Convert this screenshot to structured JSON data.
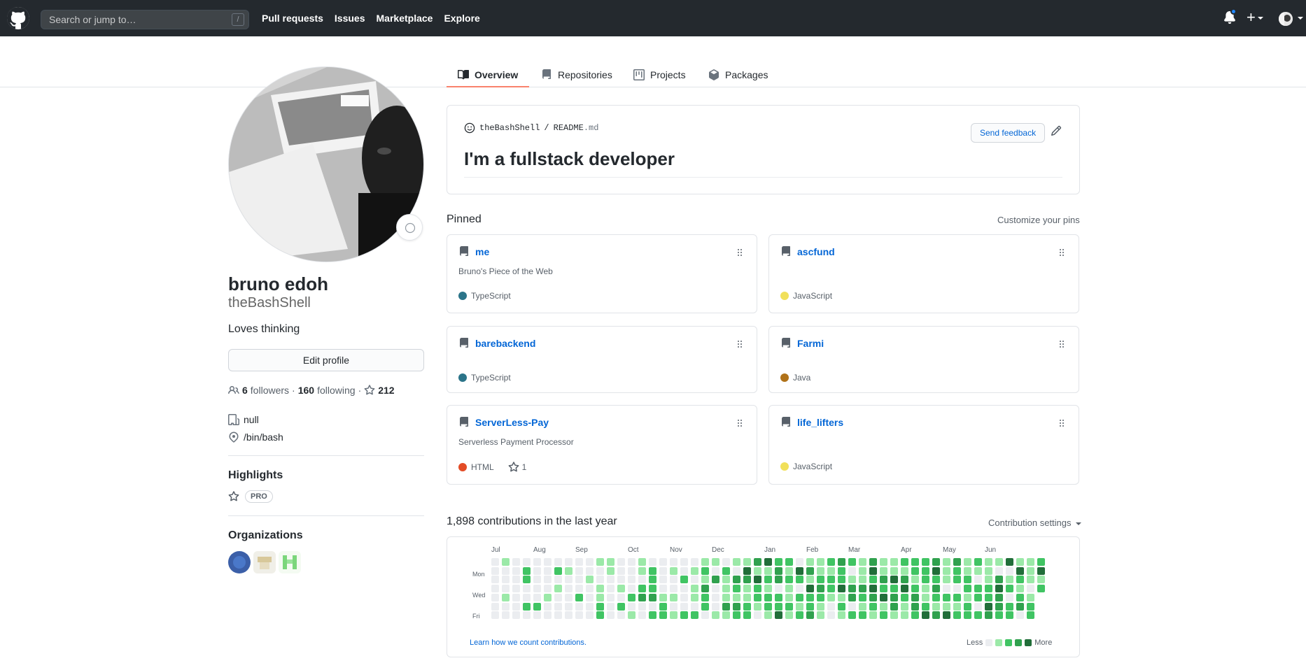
{
  "header": {
    "search_placeholder": "Search or jump to…",
    "search_shortcut": "/",
    "nav": [
      "Pull requests",
      "Issues",
      "Marketplace",
      "Explore"
    ],
    "plus_label": "+"
  },
  "tabs": [
    {
      "label": "Overview",
      "icon": "book-icon",
      "active": true
    },
    {
      "label": "Repositories",
      "icon": "repo-icon"
    },
    {
      "label": "Projects",
      "icon": "project-icon"
    },
    {
      "label": "Packages",
      "icon": "package-icon"
    }
  ],
  "profile": {
    "name": "bruno edoh",
    "login": "theBashShell",
    "bio": "Loves thinking",
    "edit_label": "Edit profile",
    "followers": "6",
    "followers_label": "followers",
    "following": "160",
    "following_label": "following",
    "stars": "212",
    "company": "null",
    "location": "/bin/bash",
    "highlights_title": "Highlights",
    "pro_badge": "PRO",
    "organizations_title": "Organizations"
  },
  "readme": {
    "owner": "theBashShell",
    "sep": "/",
    "file": "README",
    "ext": ".md",
    "feedback_label": "Send feedback",
    "heading": "I'm a fullstack developer"
  },
  "pinned": {
    "title": "Pinned",
    "customize": "Customize your pins",
    "repos": [
      {
        "name": "me",
        "desc": "Bruno's Piece of the Web",
        "lang": "TypeScript",
        "color": "#2b7489"
      },
      {
        "name": "ascfund",
        "desc": "",
        "lang": "JavaScript",
        "color": "#f1e05a"
      },
      {
        "name": "barebackend",
        "desc": "",
        "lang": "TypeScript",
        "color": "#2b7489"
      },
      {
        "name": "Farmi",
        "desc": "",
        "lang": "Java",
        "color": "#b07219"
      },
      {
        "name": "ServerLess-Pay",
        "desc": "Serverless Payment Processor",
        "lang": "HTML",
        "color": "#e34c26",
        "stars": "1"
      },
      {
        "name": "life_lifters",
        "desc": "",
        "lang": "JavaScript",
        "color": "#f1e05a"
      }
    ]
  },
  "contributions": {
    "title": "1,898 contributions in the last year",
    "settings": "Contribution settings",
    "months": [
      "Jul",
      "Aug",
      "Sep",
      "Oct",
      "Nov",
      "Dec",
      "Jan",
      "Feb",
      "Mar",
      "Apr",
      "May",
      "Jun"
    ],
    "weekdays": [
      "Mon",
      "Wed",
      "Fri"
    ],
    "learn": "Learn how we count contributions.",
    "less": "Less",
    "more": "More",
    "palette": [
      "#ebedf0",
      "#9be9a8",
      "#40c463",
      "#30a14e",
      "#216e39"
    ]
  }
}
